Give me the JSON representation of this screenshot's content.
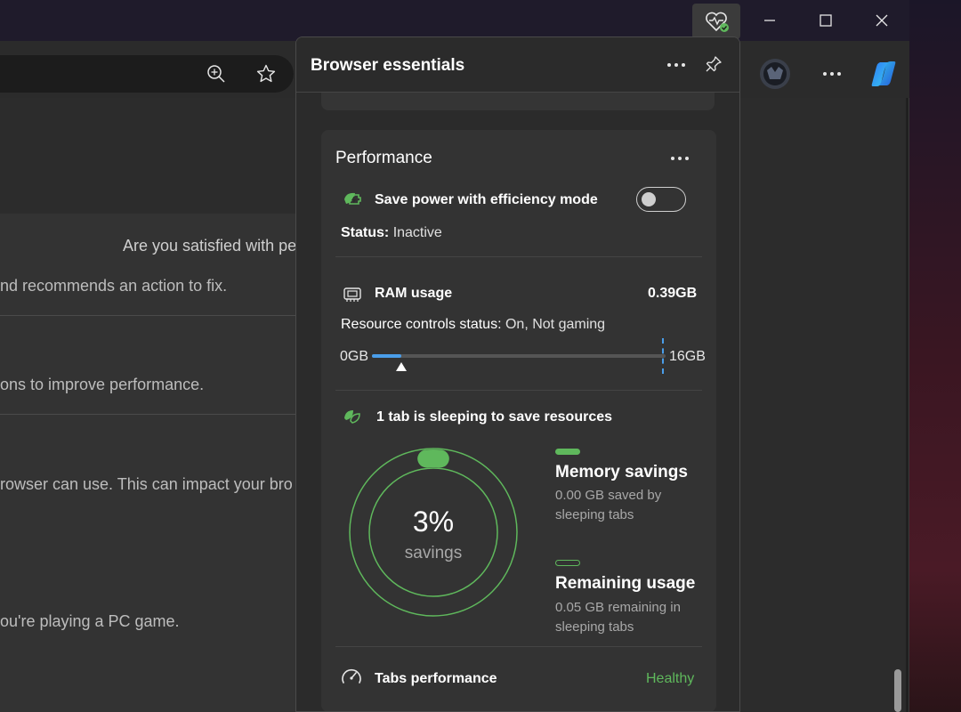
{
  "background": {
    "text_lines": [
      "Are you satisfied with pe",
      "nd recommends an action to fix.",
      "ons to improve performance.",
      "rowser can use. This can impact your bro",
      "ou're playing a PC game."
    ]
  },
  "panel": {
    "title": "Browser essentials",
    "performance": {
      "title": "Performance",
      "efficiency": {
        "label": "Save power with efficiency mode",
        "status_label": "Status:",
        "status_value": "Inactive",
        "toggle_on": false
      },
      "ram": {
        "label": "RAM usage",
        "value": "0.39GB",
        "resource_label": "Resource controls status:",
        "resource_value": "On, Not gaming",
        "min_label": "0GB",
        "max_label": "16GB",
        "usage_fraction": 0.1
      },
      "sleeping": {
        "label": "1 tab is sleeping to save resources",
        "percent": "3%",
        "percent_label": "savings",
        "memory_savings_title": "Memory savings",
        "memory_savings_desc": "0.00 GB saved by sleeping tabs",
        "remaining_title": "Remaining usage",
        "remaining_desc": "0.05 GB remaining in sleeping tabs"
      },
      "tabs": {
        "label": "Tabs performance",
        "status": "Healthy"
      }
    }
  },
  "colors": {
    "accent_green": "#5fb85c",
    "accent_blue": "#4a9eea",
    "panel_bg": "#2b2b2b"
  }
}
